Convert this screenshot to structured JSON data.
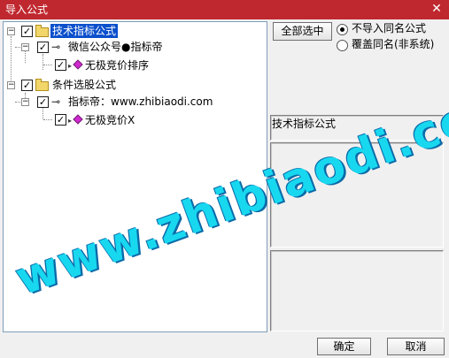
{
  "window": {
    "title": "导入公式",
    "close_glyph": "✕"
  },
  "tree": {
    "nodes": [
      {
        "label": "技术指标公式",
        "checked": true,
        "selected": true
      },
      {
        "label": "微信公众号●指标帝",
        "checked": true
      },
      {
        "label": "无极竞价排序",
        "checked": true
      },
      {
        "label": "条件选股公式",
        "checked": true
      },
      {
        "label": "指标帝：www.zhibiaodi.com",
        "checked": true
      },
      {
        "label": "无极竞价X",
        "checked": true
      }
    ],
    "expander_glyph": "−",
    "check_glyph": "✓"
  },
  "options": {
    "select_all_button": "全部选中",
    "radio_skip": "不导入同名公式",
    "radio_overwrite": "覆盖同名(非系统)",
    "selected_radio": "skip"
  },
  "info": {
    "type_label": "技术指标公式"
  },
  "footer": {
    "ok": "确定",
    "cancel": "取消"
  },
  "watermark": {
    "text": "www.zhibiaodi.com"
  },
  "colors": {
    "titlebar": "#c0282f",
    "selection": "#0a4fcc",
    "watermark": "#18d8f0"
  }
}
